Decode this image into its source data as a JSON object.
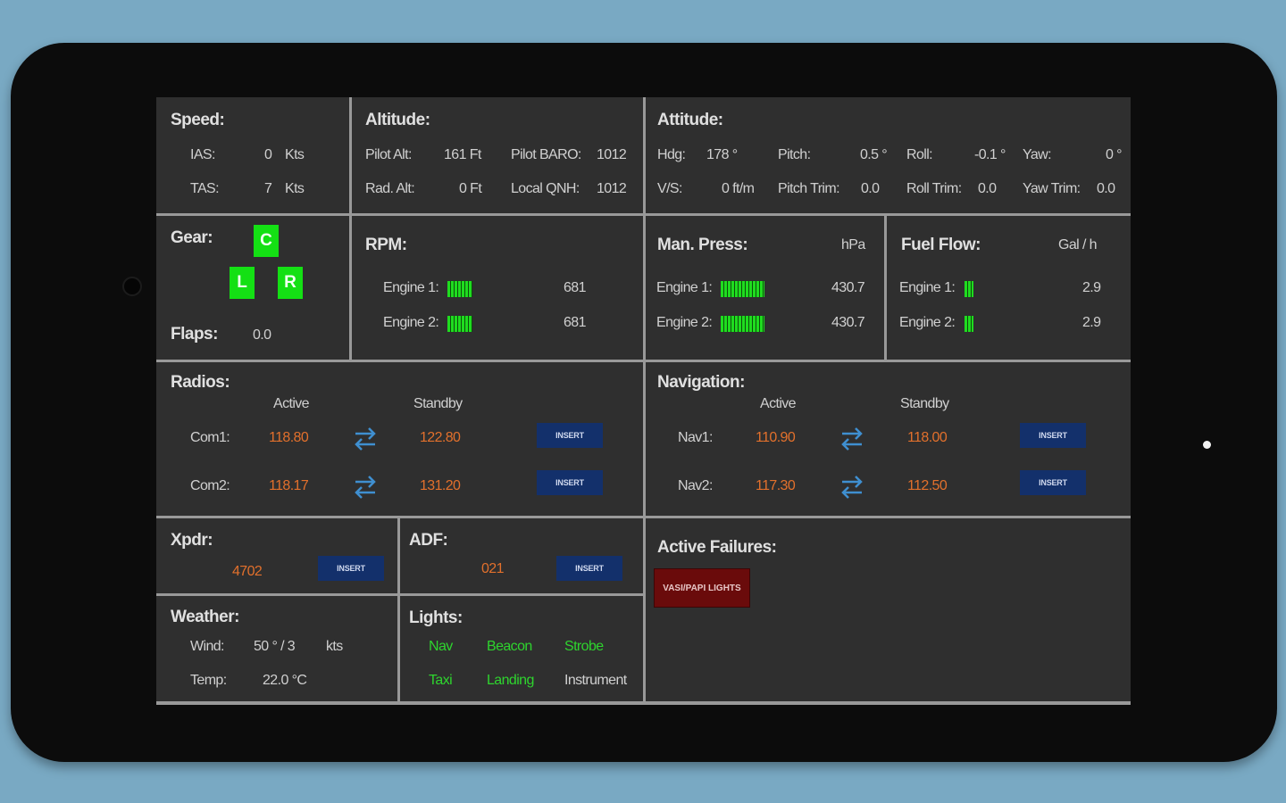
{
  "speed": {
    "title": "Speed:",
    "ias_label": "IAS:",
    "ias_value": "0",
    "ias_unit": "Kts",
    "tas_label": "TAS:",
    "tas_value": "7",
    "tas_unit": "Kts"
  },
  "altitude": {
    "title": "Altitude:",
    "pilot_alt_label": "Pilot Alt:",
    "pilot_alt_value": "161 Ft",
    "rad_alt_label": "Rad. Alt:",
    "rad_alt_value": "0 Ft",
    "pilot_baro_label": "Pilot BARO:",
    "pilot_baro_value": "1012",
    "local_qnh_label": "Local QNH:",
    "local_qnh_value": "1012"
  },
  "attitude": {
    "title": "Attitude:",
    "hdg_label": "Hdg:",
    "hdg_value": "178 °",
    "pitch_label": "Pitch:",
    "pitch_value": "0.5 °",
    "roll_label": "Roll:",
    "roll_value": "-0.1 °",
    "yaw_label": "Yaw:",
    "yaw_value": "0 °",
    "vs_label": "V/S:",
    "vs_value": "0 ft/m",
    "pitch_trim_label": "Pitch Trim:",
    "pitch_trim_value": "0.0",
    "roll_trim_label": "Roll Trim:",
    "roll_trim_value": "0.0",
    "yaw_trim_label": "Yaw Trim:",
    "yaw_trim_value": "0.0"
  },
  "gear": {
    "title": "Gear:",
    "c": "C",
    "l": "L",
    "r": "R",
    "flaps_label": "Flaps:",
    "flaps_value": "0.0",
    "color": "#14e014"
  },
  "rpm": {
    "title": "RPM:",
    "engine1_label": "Engine 1:",
    "engine1_value": "681",
    "engine2_label": "Engine 2:",
    "engine2_value": "681"
  },
  "man_press": {
    "title": "Man. Press:",
    "unit": "hPa",
    "engine1_label": "Engine 1:",
    "engine1_value": "430.7",
    "engine2_label": "Engine 2:",
    "engine2_value": "430.7"
  },
  "fuel_flow": {
    "title": "Fuel Flow:",
    "unit": "Gal / h",
    "engine1_label": "Engine 1:",
    "engine1_value": "2.9",
    "engine2_label": "Engine 2:",
    "engine2_value": "2.9"
  },
  "radios": {
    "title": "Radios:",
    "active_header": "Active",
    "standby_header": "Standby",
    "com1_label": "Com1:",
    "com1_active": "118.80",
    "com1_standby": "122.80",
    "com2_label": "Com2:",
    "com2_active": "118.17",
    "com2_standby": "131.20",
    "insert_label": "INSERT"
  },
  "navigation": {
    "title": "Navigation:",
    "active_header": "Active",
    "standby_header": "Standby",
    "nav1_label": "Nav1:",
    "nav1_active": "110.90",
    "nav1_standby": "118.00",
    "nav2_label": "Nav2:",
    "nav2_active": "117.30",
    "nav2_standby": "112.50",
    "insert_label": "INSERT"
  },
  "xpdr": {
    "title": "Xpdr:",
    "value": "4702",
    "insert_label": "INSERT"
  },
  "adf": {
    "title": "ADF:",
    "value": "021",
    "insert_label": "INSERT"
  },
  "failures": {
    "title": "Active Failures:",
    "item": "VASI/PAPI LIGHTS"
  },
  "weather": {
    "title": "Weather:",
    "wind_label": "Wind:",
    "wind_value": "50 ° / 3",
    "wind_unit": "kts",
    "temp_label": "Temp:",
    "temp_value": "22.0 °C"
  },
  "lights": {
    "title": "Lights:",
    "nav": "Nav",
    "beacon": "Beacon",
    "strobe": "Strobe",
    "taxi": "Taxi",
    "landing": "Landing",
    "instrument": "Instrument"
  },
  "colors": {
    "panel": "#2f2f2f",
    "divider": "#999999",
    "frequency": "#e2702c",
    "light_on": "#2ed42e",
    "insert_button": "#13306b",
    "failure_button": "#6a0b0b"
  },
  "icons": {
    "swap": "swap-arrows-icon"
  }
}
